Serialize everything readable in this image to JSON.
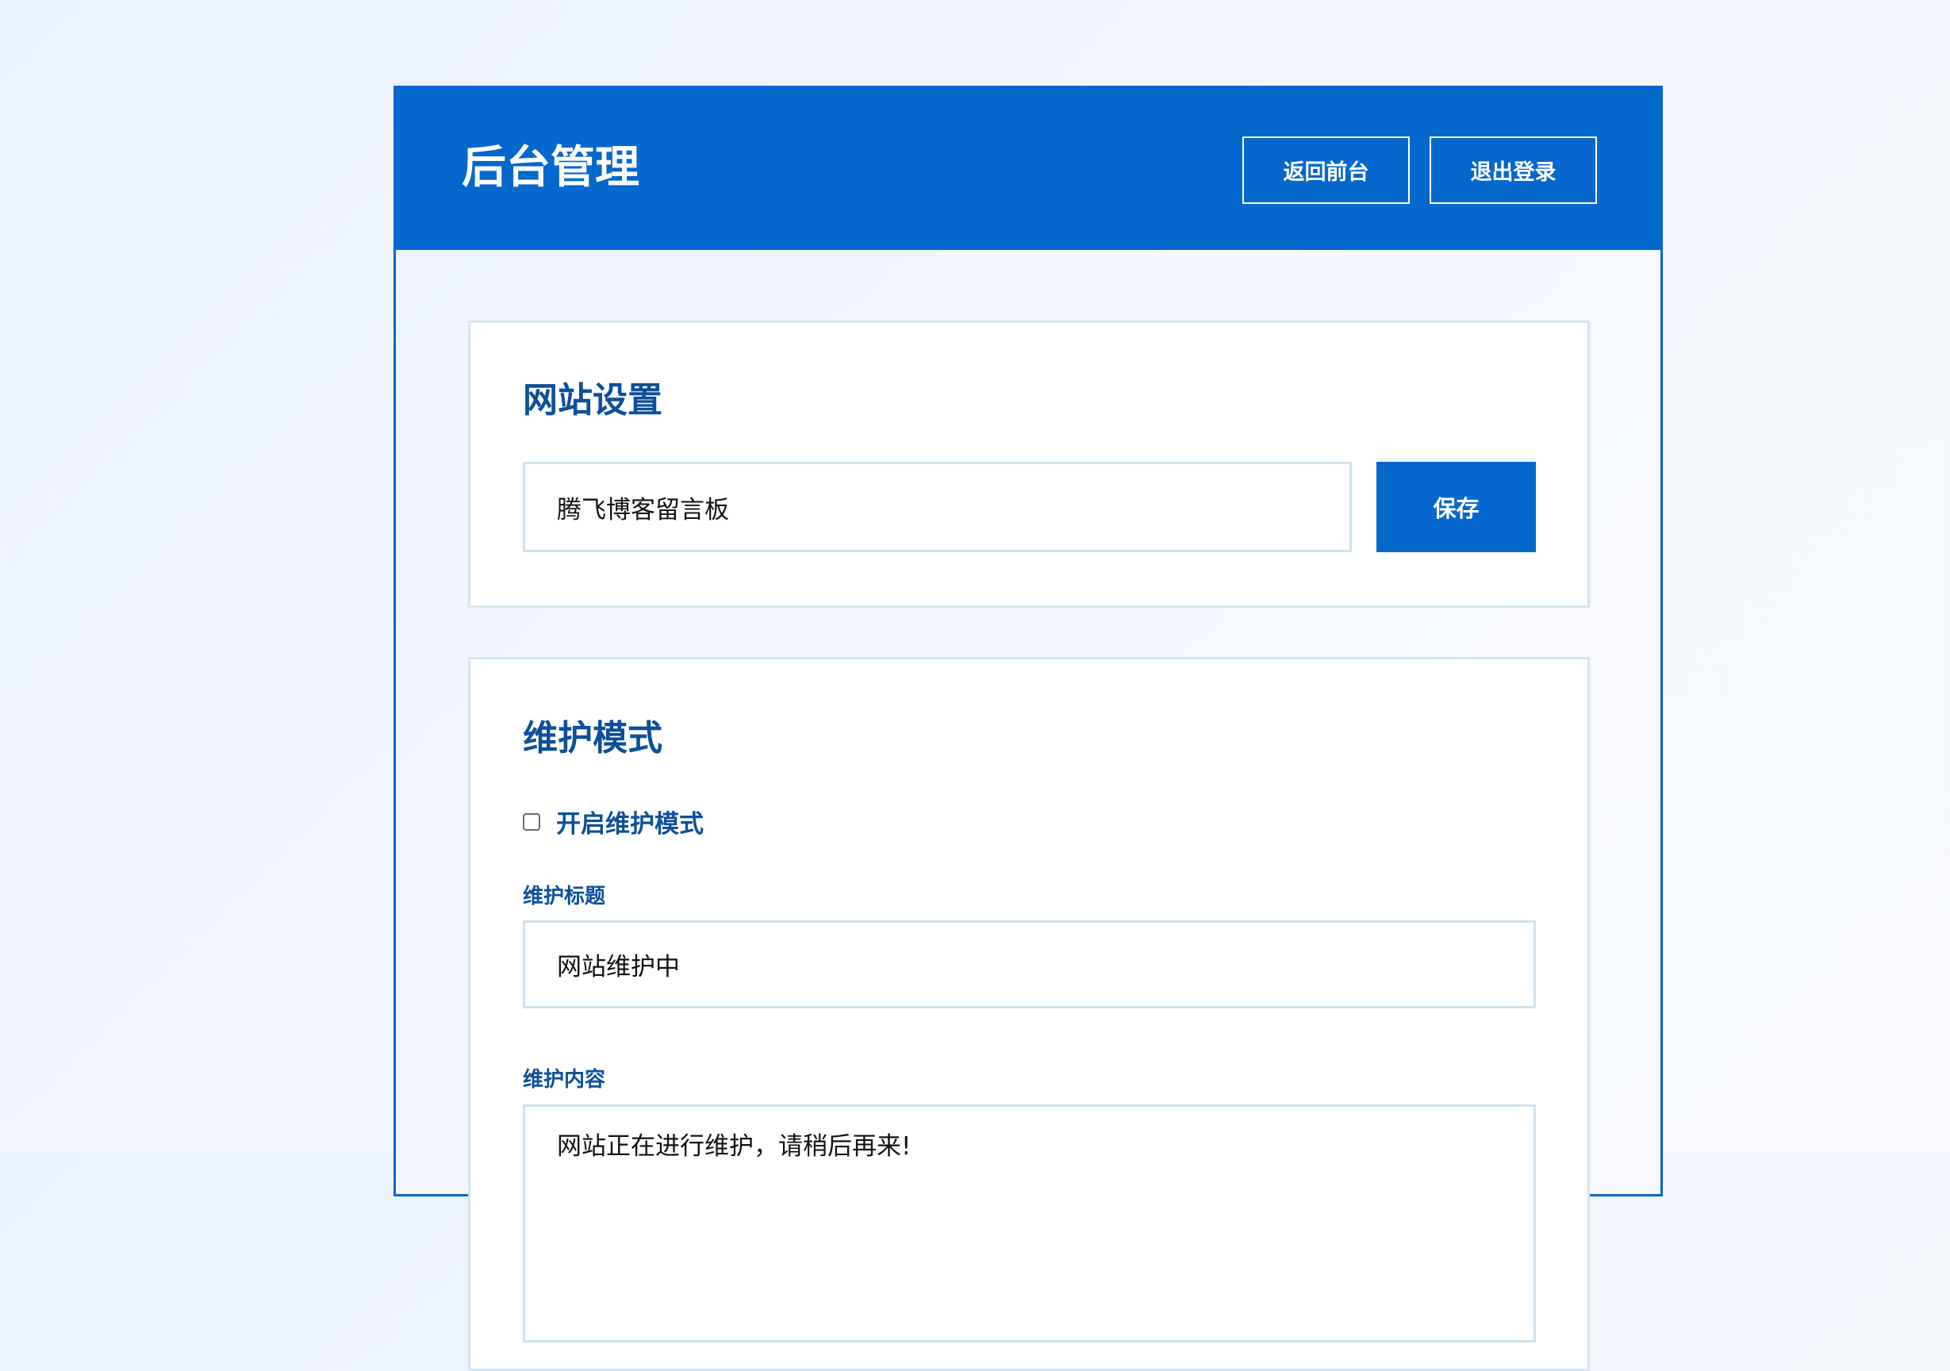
{
  "header": {
    "title": "后台管理",
    "back_to_front_label": "返回前台",
    "logout_label": "退出登录"
  },
  "site_settings": {
    "title": "网站设置",
    "site_name_value": "腾飞博客留言板",
    "save_label": "保存"
  },
  "maintenance": {
    "title": "维护模式",
    "enable_label": "开启维护模式",
    "enabled": false,
    "title_label": "维护标题",
    "title_value": "网站维护中",
    "content_label": "维护内容",
    "content_value": "网站正在进行维护，请稍后再来!"
  },
  "colors": {
    "brand": "#0568cc",
    "heading": "#0d4f9a",
    "input_border": "#cfe3ee"
  }
}
